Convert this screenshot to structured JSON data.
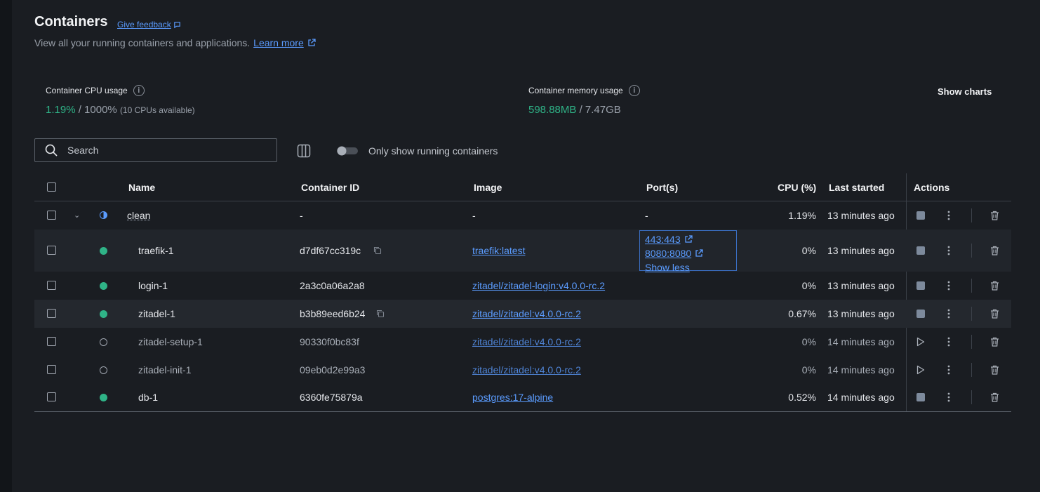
{
  "page": {
    "title": "Containers",
    "feedback_label": "Give feedback",
    "subtitle": "View all your running containers and applications.",
    "learn_more": "Learn more"
  },
  "stats": {
    "cpu_label": "Container CPU usage",
    "cpu_used": "1.19%",
    "cpu_total": "/ 1000%",
    "cpu_note": "(10 CPUs available)",
    "memory_label": "Container memory usage",
    "memory_used": "598.88MB",
    "memory_total": "/ 7.47GB",
    "show_charts": "Show charts"
  },
  "toolbar": {
    "search_placeholder": "Search",
    "running_toggle_label": "Only show running containers",
    "running_toggle_on": false
  },
  "table": {
    "headers": {
      "name": "Name",
      "container_id": "Container ID",
      "image": "Image",
      "ports": "Port(s)",
      "cpu": "CPU (%)",
      "last_started": "Last started",
      "actions": "Actions"
    },
    "group": {
      "name": "clean",
      "container_id": "-",
      "image": "-",
      "ports": "-",
      "cpu": "1.19%",
      "last_started": "13 minutes ago"
    },
    "rows": [
      {
        "name": "traefik-1",
        "status": "running",
        "container_id": "d7df67cc319c",
        "image": "traefik:latest",
        "cpu": "0%",
        "last_started": "13 minutes ago",
        "ports": [
          "443:443",
          "8080:8080"
        ],
        "ports_toggle": "Show less"
      },
      {
        "name": "login-1",
        "status": "running",
        "container_id": "2a3c0a06a2a8",
        "image": "zitadel/zitadel-login:v4.0.0-rc.2",
        "cpu": "0%",
        "last_started": "13 minutes ago"
      },
      {
        "name": "zitadel-1",
        "status": "running",
        "container_id": "b3b89eed6b24",
        "image": "zitadel/zitadel:v4.0.0-rc.2",
        "cpu": "0.67%",
        "last_started": "13 minutes ago"
      },
      {
        "name": "zitadel-setup-1",
        "status": "exited",
        "container_id": "90330f0bc83f",
        "image": "zitadel/zitadel:v4.0.0-rc.2",
        "cpu": "0%",
        "last_started": "14 minutes ago"
      },
      {
        "name": "zitadel-init-1",
        "status": "exited",
        "container_id": "09eb0d2e99a3",
        "image": "zitadel/zitadel:v4.0.0-rc.2",
        "cpu": "0%",
        "last_started": "14 minutes ago"
      },
      {
        "name": "db-1",
        "status": "running",
        "container_id": "6360fe75879a",
        "image": "postgres:17-alpine",
        "cpu": "0.52%",
        "last_started": "14 minutes ago"
      }
    ]
  },
  "colors": {
    "accent": "#5b9cff",
    "running": "#2fb387",
    "background": "#1a1d22"
  }
}
